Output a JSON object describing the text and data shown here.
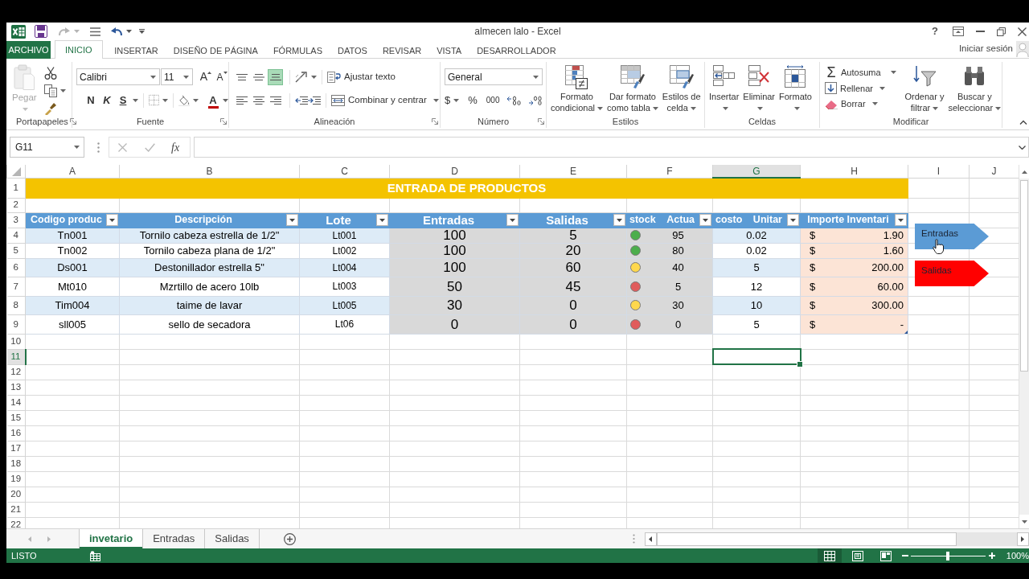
{
  "title_bar": {
    "title": "almecen lalo - Excel",
    "help": "?"
  },
  "ribbon_tabs": [
    {
      "label": "ARCHIVO",
      "kind": "file",
      "selected": false
    },
    {
      "label": "INICIO",
      "kind": "tab",
      "selected": true
    },
    {
      "label": "INSERTAR",
      "kind": "tab",
      "selected": false
    },
    {
      "label": "DISEÑO DE PÁGINA",
      "kind": "tab",
      "selected": false
    },
    {
      "label": "FÓRMULAS",
      "kind": "tab",
      "selected": false
    },
    {
      "label": "DATOS",
      "kind": "tab",
      "selected": false
    },
    {
      "label": "REVISAR",
      "kind": "tab",
      "selected": false
    },
    {
      "label": "VISTA",
      "kind": "tab",
      "selected": false
    },
    {
      "label": "DESARROLLADOR",
      "kind": "tab",
      "selected": false
    }
  ],
  "account": {
    "label": "Iniciar sesión"
  },
  "ribbon": {
    "clipboard": {
      "label": "Portapapeles",
      "paste": {
        "label": "Pegar",
        "disabled": true
      }
    },
    "font": {
      "label": "Fuente",
      "font_name": "Calibri",
      "font_size": "11",
      "grow": "A",
      "shrink": "A",
      "bold": "N",
      "italic": "K",
      "underline": "S",
      "font_color": "A"
    },
    "alignment": {
      "label": "Alineación",
      "vertical": [
        {
          "kind": "top",
          "selected": false
        },
        {
          "kind": "middle",
          "selected": false
        },
        {
          "kind": "bottom",
          "selected": true
        }
      ],
      "horizontal": [
        {
          "kind": "left",
          "selected": false
        },
        {
          "kind": "center",
          "selected": false
        },
        {
          "kind": "right",
          "selected": false
        }
      ],
      "wrap_text": "Ajustar texto",
      "merge_center": "Combinar y centrar"
    },
    "number": {
      "label": "Número",
      "format": "General",
      "currency": "$",
      "percent": "%",
      "thousands": "000"
    },
    "styles": {
      "label": "Estilos",
      "buttons": [
        {
          "kind": "conditional",
          "lines": [
            "Formato",
            "condicional"
          ]
        },
        {
          "kind": "table",
          "lines": [
            "Dar formato",
            "como tabla"
          ]
        },
        {
          "kind": "cell",
          "lines": [
            "Estilos de",
            "celda"
          ]
        }
      ]
    },
    "cells": {
      "label": "Celdas",
      "buttons": [
        {
          "kind": "insert",
          "label": "Insertar"
        },
        {
          "kind": "delete",
          "label": "Eliminar"
        },
        {
          "kind": "format",
          "label": "Formato"
        }
      ]
    },
    "editing": {
      "label": "Modificar",
      "autosum": {
        "symbol": "Σ",
        "label": "Autosuma"
      },
      "fill": "Rellenar",
      "clear": "Borrar",
      "buttons": [
        {
          "kind": "sort",
          "lines": [
            "Ordenar y",
            "filtrar"
          ]
        },
        {
          "kind": "find",
          "lines": [
            "Buscar y",
            "seleccionar"
          ]
        }
      ]
    }
  },
  "formula_bar": {
    "name_box": "G11",
    "function": "fx"
  },
  "sheet": {
    "columns": [
      {
        "label": "A",
        "selected": false
      },
      {
        "label": "B",
        "selected": false
      },
      {
        "label": "C",
        "selected": false
      },
      {
        "label": "D",
        "selected": false
      },
      {
        "label": "E",
        "selected": false
      },
      {
        "label": "F",
        "selected": false
      },
      {
        "label": "G",
        "selected": true
      },
      {
        "label": "H",
        "selected": false
      },
      {
        "label": "I",
        "selected": false
      },
      {
        "label": "J",
        "selected": false
      }
    ],
    "rows": [
      {
        "number": "1",
        "selected": false,
        "kind": "title",
        "text": "ENTRADA DE PRODUCTOS"
      },
      {
        "number": "2",
        "selected": false,
        "kind": "blank"
      },
      {
        "number": "3",
        "selected": false,
        "kind": "header",
        "cells": [
          "Codigo produc",
          "Descripción",
          "Lote",
          "Entradas",
          "Salidas",
          "stock Actua",
          "costo Unitar",
          "Importe Inventari"
        ]
      },
      {
        "number": "4",
        "selected": false,
        "kind": "item",
        "code": "Tn001",
        "description": "Tornilo cabeza estrella de 1/2\"",
        "lot": "Lt001",
        "entries": "100",
        "exits": "5",
        "color": "#4cae4c",
        "stock": "95",
        "unit_cost": "0.02",
        "currency": "$",
        "amount": "1.90"
      },
      {
        "number": "5",
        "selected": false,
        "kind": "item",
        "code": "Tn002",
        "description": "Tornilo cabeza plana de 1/2\"",
        "lot": "Lt002",
        "entries": "100",
        "exits": "20",
        "color": "#4cae4c",
        "stock": "80",
        "unit_cost": "0.02",
        "currency": "$",
        "amount": "1.60"
      },
      {
        "number": "6",
        "selected": false,
        "kind": "item",
        "code": "Ds001",
        "description": "Destonillador estrella 5\"",
        "lot": "Lt004",
        "entries": "100",
        "exits": "60",
        "color": "#ffd84d",
        "stock": "40",
        "unit_cost": "5",
        "currency": "$",
        "amount": "200.00"
      },
      {
        "number": "7",
        "selected": false,
        "kind": "item",
        "code": "Mt010",
        "description": "Mzrtillo de acero 10lb",
        "lot": "Lt003",
        "entries": "50",
        "exits": "45",
        "color": "#e05c5c",
        "stock": "5",
        "unit_cost": "12",
        "currency": "$",
        "amount": "60.00"
      },
      {
        "number": "8",
        "selected": false,
        "kind": "item",
        "code": "Tim004",
        "description": "taime de lavar",
        "lot": "Lt005",
        "entries": "30",
        "exits": "0",
        "color": "#ffd84d",
        "stock": "30",
        "unit_cost": "10",
        "currency": "$",
        "amount": "300.00"
      },
      {
        "number": "9",
        "selected": false,
        "kind": "item",
        "code": "sll005",
        "description": "sello de secadora",
        "lot": "Lt06",
        "entries": "0",
        "exits": "0",
        "color": "#e05c5c",
        "stock": "0",
        "unit_cost": "5",
        "currency": "$",
        "amount": "-"
      },
      {
        "number": "10",
        "selected": false,
        "kind": "blank"
      },
      {
        "number": "11",
        "selected": true,
        "kind": "blank"
      },
      {
        "number": "12",
        "selected": false,
        "kind": "blank"
      },
      {
        "number": "13",
        "selected": false,
        "kind": "blank"
      },
      {
        "number": "14",
        "selected": false,
        "kind": "blank"
      },
      {
        "number": "15",
        "selected": false,
        "kind": "blank"
      },
      {
        "number": "16",
        "selected": false,
        "kind": "blank"
      },
      {
        "number": "17",
        "selected": false,
        "kind": "blank"
      },
      {
        "number": "18",
        "selected": false,
        "kind": "blank"
      },
      {
        "number": "19",
        "selected": false,
        "kind": "blank"
      },
      {
        "number": "20",
        "selected": false,
        "kind": "blank"
      },
      {
        "number": "21",
        "selected": false,
        "kind": "blank"
      },
      {
        "number": "22",
        "selected": false,
        "kind": "blank"
      }
    ],
    "shapes": [
      {
        "label": "Entradas",
        "color": "#5b9bd5"
      },
      {
        "label": "Salidas",
        "color": "#ff0000"
      }
    ]
  },
  "sheet_tabs": [
    {
      "label": "invetario",
      "selected": true
    },
    {
      "label": "Entradas",
      "selected": false
    },
    {
      "label": "Salidas",
      "selected": false
    }
  ],
  "status_bar": {
    "mode": "LISTO",
    "views": [
      {
        "kind": "normal",
        "selected": true
      },
      {
        "kind": "page_layout",
        "selected": false
      },
      {
        "kind": "page_break",
        "selected": false
      }
    ],
    "zoom": {
      "level": 0.5,
      "reading": "100%"
    }
  }
}
